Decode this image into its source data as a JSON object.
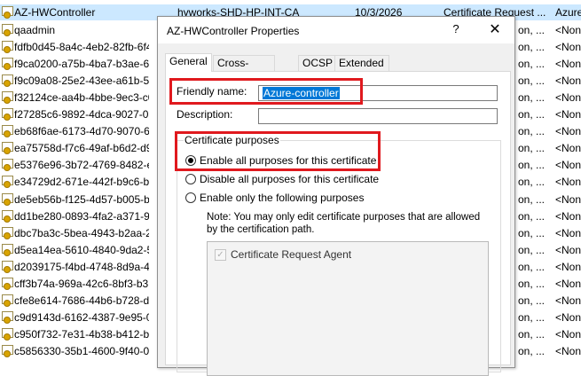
{
  "list": {
    "selected_row": {
      "name": "AZ-HWController",
      "issuer": "hyworks-SHD-HP-INT-CA",
      "expiry": "10/3/2026",
      "purpose": "Certificate Request ...",
      "friendly": "Azure"
    },
    "rows": [
      {
        "name": "qaadmin",
        "right_a": "on, ...",
        "friendly": "<Non"
      },
      {
        "name": "fdfb0d45-8a4c-4eb2-82fb-6f4f",
        "right_a": "on, ...",
        "friendly": "<Non"
      },
      {
        "name": "f9ca0200-a75b-4ba7-b3ae-672",
        "right_a": "on, ...",
        "friendly": "<Non"
      },
      {
        "name": "f9c09a08-25e2-43ee-a61b-5c0a",
        "right_a": "on, ...",
        "friendly": "<Non"
      },
      {
        "name": "f32124ce-aa4b-4bbe-9ec3-c0e",
        "right_a": "on, ...",
        "friendly": "<Non"
      },
      {
        "name": "f27285c6-9892-4dca-9027-0337",
        "right_a": "on, ...",
        "friendly": "<Non"
      },
      {
        "name": "eb68f6ae-6173-4d70-9070-6832",
        "right_a": "on, ...",
        "friendly": "<Non"
      },
      {
        "name": "ea75758d-f7c6-49af-b6d2-d996",
        "right_a": "on, ...",
        "friendly": "<Non"
      },
      {
        "name": "e5376e96-3b72-4769-8482-eb8",
        "right_a": "on, ...",
        "friendly": "<Non"
      },
      {
        "name": "e34729d2-671e-442f-b9c6-b909",
        "right_a": "on, ...",
        "friendly": "<Non"
      },
      {
        "name": "de5eb56b-f125-4d57-b005-b1f",
        "right_a": "on, ...",
        "friendly": "<Non"
      },
      {
        "name": "dd1be280-0893-4fa2-a371-9893",
        "right_a": "on, ...",
        "friendly": "<Non"
      },
      {
        "name": "dbc7ba3c-5bea-4943-b2aa-215",
        "right_a": "on, ...",
        "friendly": "<Non"
      },
      {
        "name": "d5ea14ea-5610-4840-9da2-507",
        "right_a": "on, ...",
        "friendly": "<Non"
      },
      {
        "name": "d2039175-f4bd-4748-8d9a-459",
        "right_a": "on, ...",
        "friendly": "<Non"
      },
      {
        "name": "cff3b74a-969a-42c6-8bf3-b3ba",
        "right_a": "on, ...",
        "friendly": "<Non"
      },
      {
        "name": "cfe8e614-7686-44b6-b728-d552",
        "right_a": "on, ...",
        "friendly": "<Non"
      },
      {
        "name": "c9d9143d-6162-4387-9e95-0c1",
        "right_a": "on, ...",
        "friendly": "<Non"
      },
      {
        "name": "c950f732-7e31-4b38-b412-b339",
        "right_a": "on, ...",
        "friendly": "<Non"
      },
      {
        "name": "c5856330-35b1-4600-9f40-0514",
        "right_a": "on, ...",
        "friendly": "<Non"
      }
    ]
  },
  "dialog": {
    "title": "AZ-HWController Properties",
    "help_glyph": "?",
    "close_glyph": "✕",
    "tabs": [
      {
        "label": "General",
        "active": true
      },
      {
        "label": "Cross-Certificates",
        "active": false
      },
      {
        "label": "OCSP",
        "active": false
      },
      {
        "label": "Extended Validation",
        "active": false
      }
    ],
    "general": {
      "friendly_name_label": "Friendly name:",
      "friendly_name_value": "Azure-controller",
      "description_label": "Description:",
      "description_value": "",
      "purposes_group_title": "Certificate purposes",
      "options": [
        {
          "label": "Enable all purposes for this certificate",
          "selected": true
        },
        {
          "label": "Disable all purposes for this certificate",
          "selected": false
        },
        {
          "label": "Enable only the following purposes",
          "selected": false
        }
      ],
      "note": "Note: You may only edit certificate purposes that are allowed by the certification path.",
      "purposes": [
        {
          "label": "Certificate Request Agent",
          "checked": true,
          "enabled": false
        }
      ]
    }
  },
  "colors": {
    "highlight_red": "#e0191e",
    "selection_blue": "#0078d7",
    "row_selected": "#cce8ff"
  }
}
